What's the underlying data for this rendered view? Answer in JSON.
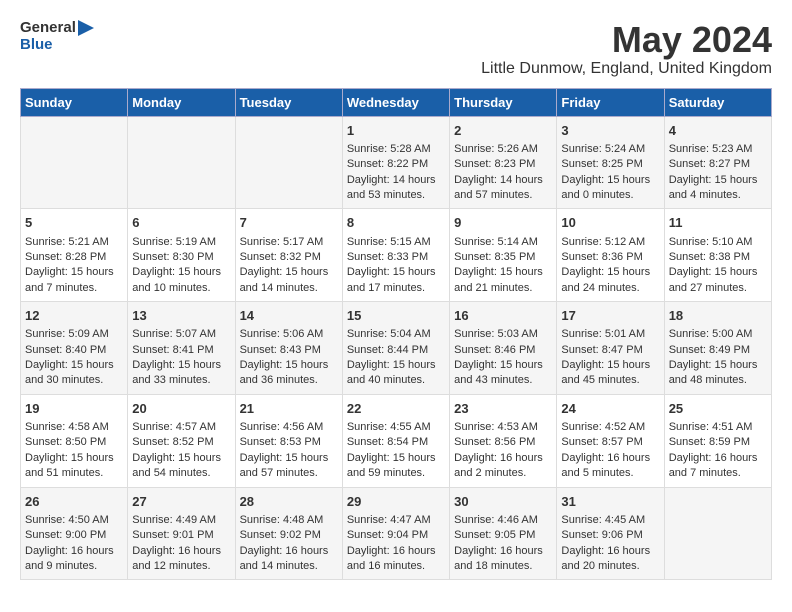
{
  "logo": {
    "general": "General",
    "blue": "Blue"
  },
  "title": "May 2024",
  "location": "Little Dunmow, England, United Kingdom",
  "days_of_week": [
    "Sunday",
    "Monday",
    "Tuesday",
    "Wednesday",
    "Thursday",
    "Friday",
    "Saturday"
  ],
  "weeks": [
    [
      {
        "day": "",
        "content": ""
      },
      {
        "day": "",
        "content": ""
      },
      {
        "day": "",
        "content": ""
      },
      {
        "day": "1",
        "content": "Sunrise: 5:28 AM\nSunset: 8:22 PM\nDaylight: 14 hours\nand 53 minutes."
      },
      {
        "day": "2",
        "content": "Sunrise: 5:26 AM\nSunset: 8:23 PM\nDaylight: 14 hours\nand 57 minutes."
      },
      {
        "day": "3",
        "content": "Sunrise: 5:24 AM\nSunset: 8:25 PM\nDaylight: 15 hours\nand 0 minutes."
      },
      {
        "day": "4",
        "content": "Sunrise: 5:23 AM\nSunset: 8:27 PM\nDaylight: 15 hours\nand 4 minutes."
      }
    ],
    [
      {
        "day": "5",
        "content": "Sunrise: 5:21 AM\nSunset: 8:28 PM\nDaylight: 15 hours\nand 7 minutes."
      },
      {
        "day": "6",
        "content": "Sunrise: 5:19 AM\nSunset: 8:30 PM\nDaylight: 15 hours\nand 10 minutes."
      },
      {
        "day": "7",
        "content": "Sunrise: 5:17 AM\nSunset: 8:32 PM\nDaylight: 15 hours\nand 14 minutes."
      },
      {
        "day": "8",
        "content": "Sunrise: 5:15 AM\nSunset: 8:33 PM\nDaylight: 15 hours\nand 17 minutes."
      },
      {
        "day": "9",
        "content": "Sunrise: 5:14 AM\nSunset: 8:35 PM\nDaylight: 15 hours\nand 21 minutes."
      },
      {
        "day": "10",
        "content": "Sunrise: 5:12 AM\nSunset: 8:36 PM\nDaylight: 15 hours\nand 24 minutes."
      },
      {
        "day": "11",
        "content": "Sunrise: 5:10 AM\nSunset: 8:38 PM\nDaylight: 15 hours\nand 27 minutes."
      }
    ],
    [
      {
        "day": "12",
        "content": "Sunrise: 5:09 AM\nSunset: 8:40 PM\nDaylight: 15 hours\nand 30 minutes."
      },
      {
        "day": "13",
        "content": "Sunrise: 5:07 AM\nSunset: 8:41 PM\nDaylight: 15 hours\nand 33 minutes."
      },
      {
        "day": "14",
        "content": "Sunrise: 5:06 AM\nSunset: 8:43 PM\nDaylight: 15 hours\nand 36 minutes."
      },
      {
        "day": "15",
        "content": "Sunrise: 5:04 AM\nSunset: 8:44 PM\nDaylight: 15 hours\nand 40 minutes."
      },
      {
        "day": "16",
        "content": "Sunrise: 5:03 AM\nSunset: 8:46 PM\nDaylight: 15 hours\nand 43 minutes."
      },
      {
        "day": "17",
        "content": "Sunrise: 5:01 AM\nSunset: 8:47 PM\nDaylight: 15 hours\nand 45 minutes."
      },
      {
        "day": "18",
        "content": "Sunrise: 5:00 AM\nSunset: 8:49 PM\nDaylight: 15 hours\nand 48 minutes."
      }
    ],
    [
      {
        "day": "19",
        "content": "Sunrise: 4:58 AM\nSunset: 8:50 PM\nDaylight: 15 hours\nand 51 minutes."
      },
      {
        "day": "20",
        "content": "Sunrise: 4:57 AM\nSunset: 8:52 PM\nDaylight: 15 hours\nand 54 minutes."
      },
      {
        "day": "21",
        "content": "Sunrise: 4:56 AM\nSunset: 8:53 PM\nDaylight: 15 hours\nand 57 minutes."
      },
      {
        "day": "22",
        "content": "Sunrise: 4:55 AM\nSunset: 8:54 PM\nDaylight: 15 hours\nand 59 minutes."
      },
      {
        "day": "23",
        "content": "Sunrise: 4:53 AM\nSunset: 8:56 PM\nDaylight: 16 hours\nand 2 minutes."
      },
      {
        "day": "24",
        "content": "Sunrise: 4:52 AM\nSunset: 8:57 PM\nDaylight: 16 hours\nand 5 minutes."
      },
      {
        "day": "25",
        "content": "Sunrise: 4:51 AM\nSunset: 8:59 PM\nDaylight: 16 hours\nand 7 minutes."
      }
    ],
    [
      {
        "day": "26",
        "content": "Sunrise: 4:50 AM\nSunset: 9:00 PM\nDaylight: 16 hours\nand 9 minutes."
      },
      {
        "day": "27",
        "content": "Sunrise: 4:49 AM\nSunset: 9:01 PM\nDaylight: 16 hours\nand 12 minutes."
      },
      {
        "day": "28",
        "content": "Sunrise: 4:48 AM\nSunset: 9:02 PM\nDaylight: 16 hours\nand 14 minutes."
      },
      {
        "day": "29",
        "content": "Sunrise: 4:47 AM\nSunset: 9:04 PM\nDaylight: 16 hours\nand 16 minutes."
      },
      {
        "day": "30",
        "content": "Sunrise: 4:46 AM\nSunset: 9:05 PM\nDaylight: 16 hours\nand 18 minutes."
      },
      {
        "day": "31",
        "content": "Sunrise: 4:45 AM\nSunset: 9:06 PM\nDaylight: 16 hours\nand 20 minutes."
      },
      {
        "day": "",
        "content": ""
      }
    ]
  ]
}
